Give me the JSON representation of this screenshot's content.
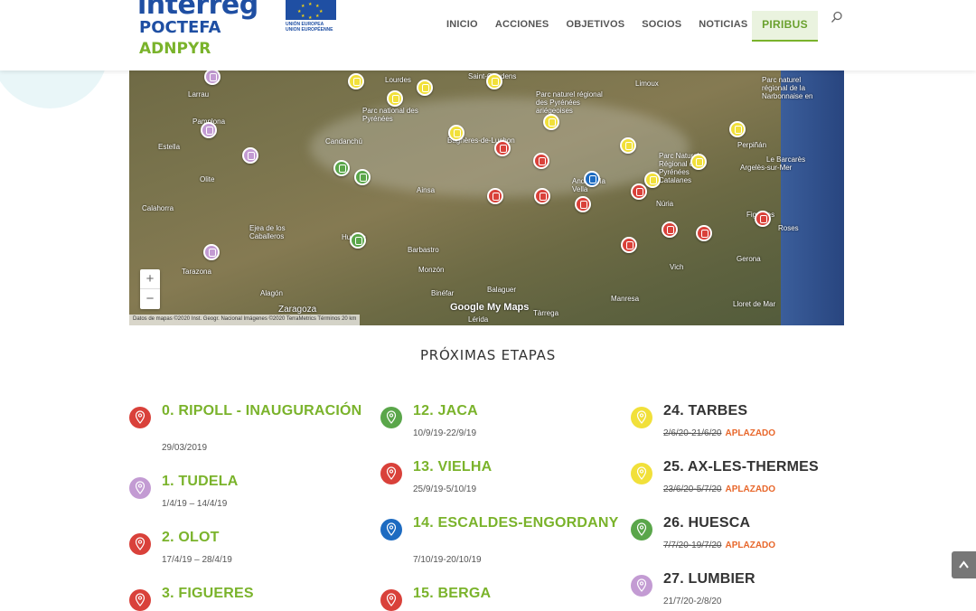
{
  "header": {
    "logo_line1": "interreg",
    "logo_line2": "POCTEFA",
    "logo_line3": "ADNPYR",
    "eu_line1": "UNIÓN EUROPEA",
    "eu_line2": "UNION EUROPÉENNE",
    "nav": [
      "INICIO",
      "ACCIONES",
      "OBJETIVOS",
      "SOCIOS",
      "NOTICIAS"
    ],
    "nav_button": "PIRIBUS"
  },
  "map": {
    "labels": [
      "Larrau",
      "Lourdes",
      "Saint-Gaudens",
      "Limoux",
      "Parc naturel régional de la Narbonnaise en",
      "Pamplona",
      "Parc national des Pyrénées",
      "Parc naturel régional des Pyrénées ariégeoises",
      "Estella",
      "Candanchú",
      "Bagnères-de-Luchon",
      "Perpiñán",
      "Le Barcarès",
      "Olite",
      "Ainsa",
      "Andorra la Vella",
      "Parc Naturel Régional des Pyrénées Catalanes",
      "Argelès-sur-Mer",
      "Calahorra",
      "Ejea de los Caballeros",
      "Huesca",
      "Barbastro",
      "Núria",
      "Figueres",
      "Roses",
      "Tarazona",
      "Monzón",
      "Vich",
      "Gerona",
      "Alagón",
      "Binéfar",
      "Balaguer",
      "Manresa",
      "Zaragoza",
      "Lérida",
      "Tàrrega",
      "Lloret de Mar"
    ],
    "google_label": "Google My Maps",
    "attribution": "Datos de mapas ©2020 Inst. Geogr. Nacional Imágenes ©2020 TerraMetrics   Términos   20 km",
    "zoom_in": "+",
    "zoom_out": "−"
  },
  "section_title": "PRÓXIMAS ETAPAS",
  "colors": {
    "red": "#d9413a",
    "purple": "#c39bd3",
    "green": "#5aa64a",
    "blue": "#1d6bc1",
    "yellow": "#f1e03a",
    "accent": "#7ab32b",
    "postponed": "#e8672b"
  },
  "stages": {
    "col1": [
      {
        "name": "0. RIPOLL - INAUGURACIÓN",
        "date": "29/03/2019",
        "color": "red"
      },
      {
        "name": "1. TUDELA",
        "date": "1/4/19 – 14/4/19",
        "color": "purple"
      },
      {
        "name": "2. OLOT",
        "date": "17/4/19 – 28/4/19",
        "color": "red"
      },
      {
        "name": "3. FIGUERES",
        "date": "",
        "color": "red"
      }
    ],
    "col2": [
      {
        "name": "12. JACA",
        "date": "10/9/19-22/9/19",
        "color": "green"
      },
      {
        "name": "13. VIELHA",
        "date": "25/9/19-5/10/19",
        "color": "red"
      },
      {
        "name": "14. ESCALDES-ENGORDANY",
        "date": "7/10/19-20/10/19",
        "color": "blue"
      },
      {
        "name": "15. BERGA",
        "date": "",
        "color": "red"
      }
    ],
    "col3": [
      {
        "name": "24. TARBES",
        "date": "2/6/20-21/6/20",
        "status": "APLAZADO",
        "color": "yellow"
      },
      {
        "name": "25. AX-LES-THERMES",
        "date": "23/6/20-5/7/20",
        "status": "APLAZADO",
        "color": "yellow"
      },
      {
        "name": "26. HUESCA",
        "date": "7/7/20-19/7/20",
        "status": "APLAZADO",
        "color": "green"
      },
      {
        "name": "27. LUMBIER",
        "date": "21/7/20-2/8/20",
        "color": "purple"
      }
    ]
  }
}
